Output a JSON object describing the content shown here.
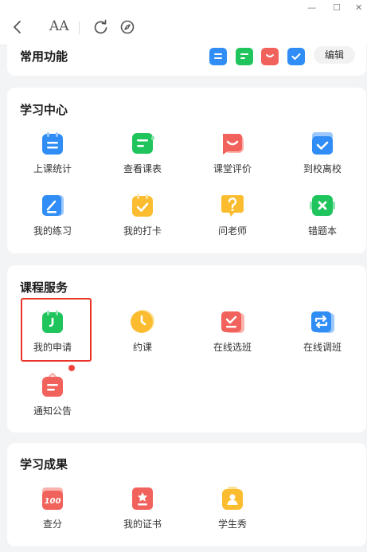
{
  "window": {
    "minimize": "—",
    "maximize": "☐",
    "close": "✕"
  },
  "toolbar": {
    "font_size_label": "AA"
  },
  "common": {
    "title": "常用功能",
    "edit_label": "编辑"
  },
  "learning_center": {
    "title": "学习中心",
    "items": [
      {
        "label": "上课统计",
        "icon": "class-stats-icon"
      },
      {
        "label": "查看课表",
        "icon": "schedule-icon"
      },
      {
        "label": "课堂评价",
        "icon": "class-review-icon"
      },
      {
        "label": "到校离校",
        "icon": "checkin-icon"
      },
      {
        "label": "我的练习",
        "icon": "practice-icon"
      },
      {
        "label": "我的打卡",
        "icon": "punch-in-icon"
      },
      {
        "label": "问老师",
        "icon": "ask-teacher-icon"
      },
      {
        "label": "错题本",
        "icon": "wrong-questions-icon"
      }
    ]
  },
  "course_services": {
    "title": "课程服务",
    "items": [
      {
        "label": "我的申请",
        "icon": "application-icon"
      },
      {
        "label": "约课",
        "icon": "book-class-icon"
      },
      {
        "label": "在线选班",
        "icon": "select-class-icon"
      },
      {
        "label": "在线调班",
        "icon": "swap-class-icon"
      },
      {
        "label": "通知公告",
        "icon": "notice-icon"
      }
    ]
  },
  "achievements": {
    "title": "学习成果",
    "items": [
      {
        "label": "查分",
        "icon": "score-icon",
        "badge": "100"
      },
      {
        "label": "我的证书",
        "icon": "certificate-icon"
      },
      {
        "label": "学生秀",
        "icon": "student-show-icon"
      }
    ]
  },
  "colors": {
    "blue": "#2f8df5",
    "green": "#1fc45c",
    "red": "#f2625c",
    "yellow": "#fbbd2f",
    "highlight": "#e8332a"
  }
}
